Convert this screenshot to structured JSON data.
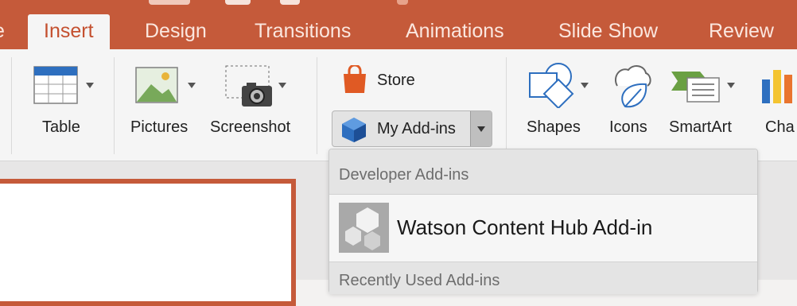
{
  "tabs": {
    "partial": "e",
    "insert": "Insert",
    "design": "Design",
    "transitions": "Transitions",
    "animations": "Animations",
    "slide_show": "Slide Show",
    "review": "Review"
  },
  "ribbon": {
    "table": "Table",
    "pictures": "Pictures",
    "screenshot": "Screenshot",
    "store": "Store",
    "my_addins": "My Add-ins",
    "shapes": "Shapes",
    "icons": "Icons",
    "smartart": "SmartArt",
    "chart": "Cha"
  },
  "addins_menu": {
    "developer_header": "Developer Add-ins",
    "item_name": "Watson Content Hub Add-in",
    "recent_header": "Recently Used Add-ins"
  },
  "colors": {
    "accent": "#c55a3a",
    "store_orange": "#e05a24",
    "icon_blue": "#2e6fbf"
  }
}
